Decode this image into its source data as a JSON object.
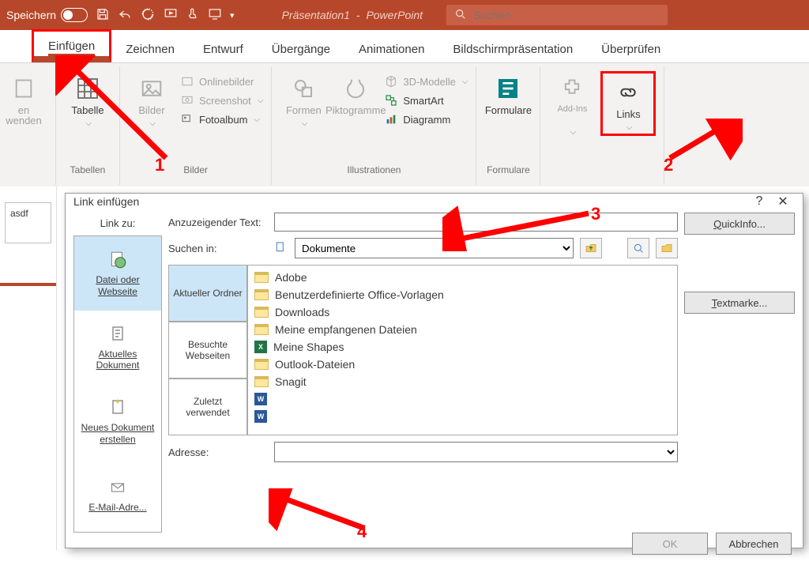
{
  "titlebar": {
    "autosave_label": "Speichern",
    "doc_title": "Präsentation1",
    "app_name": "PowerPoint",
    "search_placeholder": "Suchen"
  },
  "tabs": {
    "insert": "Einfügen",
    "draw": "Zeichnen",
    "design": "Entwurf",
    "transitions": "Übergänge",
    "animations": "Animationen",
    "slideshow": "Bildschirmpräsentation",
    "review": "Überprüfen"
  },
  "ribbon": {
    "wenden_top": "en",
    "wenden_bottom": "wenden",
    "table": "Tabelle",
    "group_tables": "Tabellen",
    "images": "Bilder",
    "online_images": "Onlinebilder",
    "screenshot": "Screenshot",
    "photoalbum": "Fotoalbum",
    "group_images": "Bilder",
    "shapes": "Formen",
    "icons": "Piktogramme",
    "models3d": "3D-Modelle",
    "smartart": "SmartArt",
    "chart": "Diagramm",
    "group_illustrations": "Illustrationen",
    "forms": "Formulare",
    "group_forms": "Formulare",
    "addins": "Add-Ins",
    "links": "Links"
  },
  "slide_thumb_text": "asdf",
  "dialog": {
    "title": "Link einfügen",
    "help_char": "?",
    "close_char": "✕",
    "link_to_header": "Link zu:",
    "opt_file": "Datei oder Webseite",
    "opt_doc": "Aktuelles Dokument",
    "opt_new": "Neues Dokument erstellen",
    "opt_mail": "E-Mail-Adre...",
    "display_text_label": "Anzuzeigender Text:",
    "quickinfo_btn": "QuickInfo...",
    "look_in_label": "Suchen in:",
    "look_in_value": "Dokumente",
    "bookmark_btn": "Textmarke...",
    "ftab_current": "Aktueller Ordner",
    "ftab_browsed": "Besuchte Webseiten",
    "ftab_recent": "Zuletzt verwendet",
    "files": [
      "Adobe",
      "Benutzerdefinierte Office-Vorlagen",
      "Downloads",
      "Meine empfangenen Dateien",
      "Meine Shapes",
      "Outlook-Dateien",
      "Snagit"
    ],
    "address_label": "Adresse:",
    "ok_btn": "OK",
    "cancel_btn": "Abbrechen"
  },
  "annotations": {
    "n1": "1",
    "n2": "2",
    "n3": "3",
    "n4": "4"
  }
}
